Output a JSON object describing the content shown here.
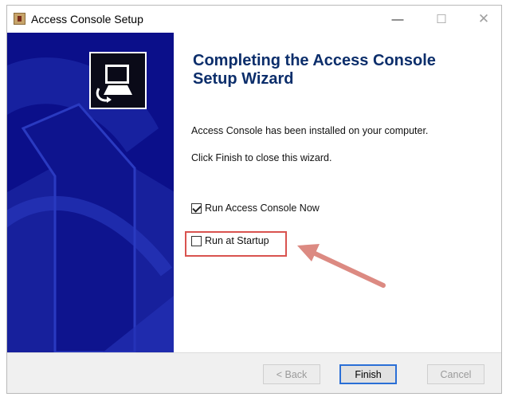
{
  "window": {
    "title": "Access Console Setup",
    "controls": {
      "minimize": "—",
      "maximize": "☐",
      "close": "✕"
    }
  },
  "wizard": {
    "heading_line1": "Completing the Access Console",
    "heading_line2": "Setup Wizard",
    "installed_text": "Access Console has been installed on your computer.",
    "finish_hint": "Click Finish to close this wizard."
  },
  "options": [
    {
      "label": "Run Access Console Now",
      "checked": true
    },
    {
      "label": "Run at Startup",
      "checked": false
    }
  ],
  "buttons": {
    "back": "< Back",
    "finish": "Finish",
    "cancel": "Cancel"
  },
  "colors": {
    "sidebar": "#0b0f8a",
    "heading": "#0c2e6b",
    "annotation": "#d9534f",
    "arrow": "#dc8a82"
  }
}
